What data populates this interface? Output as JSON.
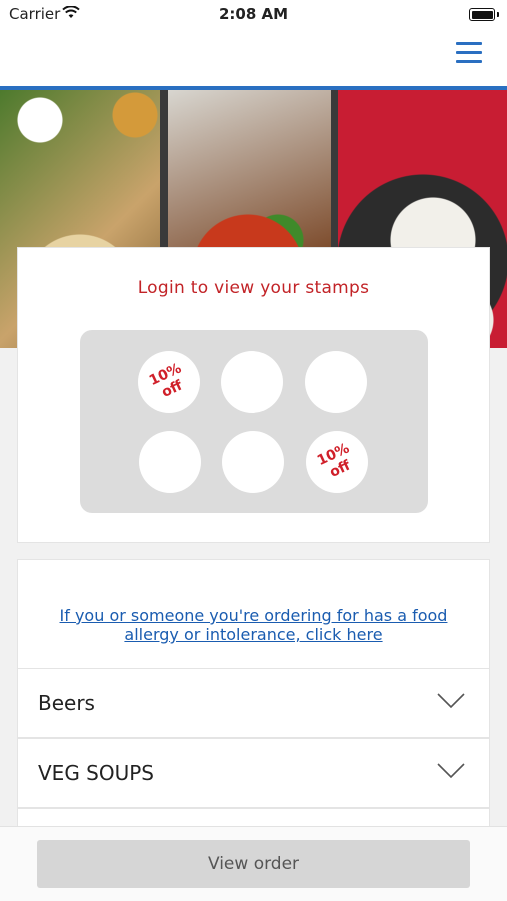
{
  "status_bar": {
    "carrier": "Carrier",
    "time": "2:08 AM"
  },
  "navbar": {
    "accent_color": "#2a6fc1",
    "menu_icon": "hamburger-menu-icon"
  },
  "stamp_card": {
    "title": "Login to view your stamps",
    "stamps": [
      {
        "label": "10%\noff",
        "filled": true
      },
      {
        "label": "",
        "filled": false
      },
      {
        "label": "",
        "filled": false
      },
      {
        "label": "",
        "filled": false
      },
      {
        "label": "",
        "filled": false
      },
      {
        "label": "10%\noff",
        "filled": true
      }
    ]
  },
  "allergy": {
    "link_text": "If you or someone you're ordering for has a food allergy or intolerance, click here"
  },
  "categories": [
    {
      "label": "Beers"
    },
    {
      "label": "VEG SOUPS"
    }
  ],
  "bottom_bar": {
    "view_order_label": "View order"
  }
}
